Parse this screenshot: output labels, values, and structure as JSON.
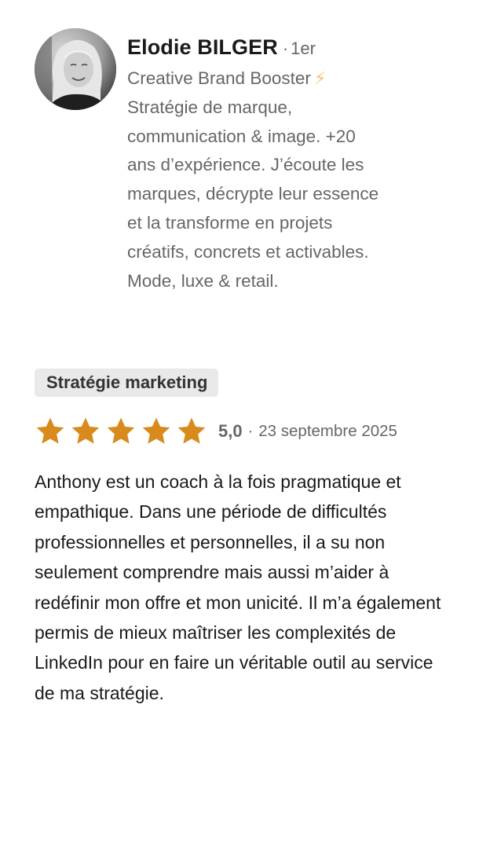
{
  "review": {
    "author": {
      "name": "Elodie BILGER",
      "separator": "·",
      "connection_degree": "1er",
      "headline": "Creative Brand Booster",
      "headline_icon": "lightning-bolt-icon",
      "headline_icon_glyph": "⚡",
      "bio": "Stratégie de marque, communication & image. +20 ans d’expérience. J’écoute les marques, décrypte leur essence et la transforme en projets créatifs, concrets et activables. Mode, luxe & retail."
    },
    "skill_tag": "Stratégie marketing",
    "rating": {
      "stars": 5,
      "max_stars": 5,
      "value_label": "5,0",
      "separator": "·",
      "date": "23 septembre 2025",
      "star_color": "#D88A1C"
    },
    "text": "Anthony est un coach à la fois pragmatique et empathique. Dans une période de difficultés professionnelles et personnelles, il a su non seulement comprendre mais aussi m’aider à redéfinir mon offre et mon unicité. Il m’a également permis de mieux maîtriser les complexités de LinkedIn pour en faire un véritable outil au service de ma stratégie."
  }
}
